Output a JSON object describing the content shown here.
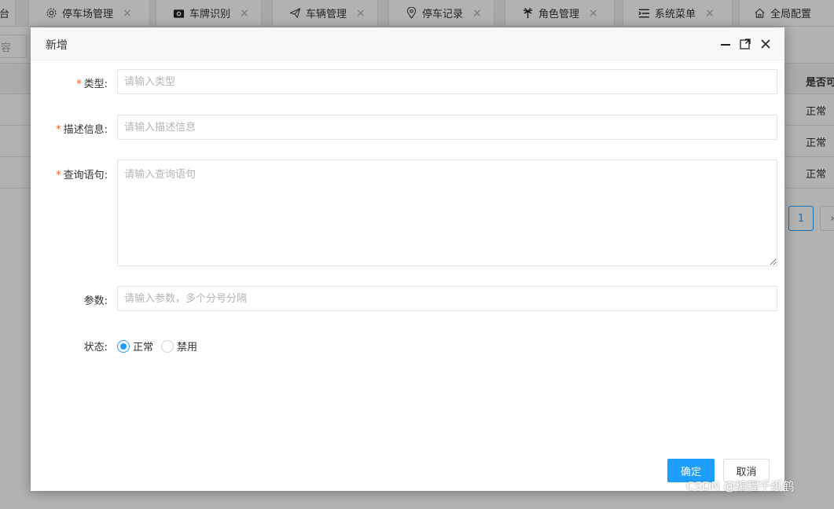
{
  "tabs": [
    {
      "label": "台",
      "icon": "none",
      "show_close": false
    },
    {
      "label": "停车场管理",
      "icon": "gear-icon",
      "show_close": true
    },
    {
      "label": "车牌识别",
      "icon": "camera-icon",
      "show_close": true
    },
    {
      "label": "车辆管理",
      "icon": "send-icon",
      "show_close": true
    },
    {
      "label": "停车记录",
      "icon": "location-pin-icon",
      "show_close": true
    },
    {
      "label": "角色管理",
      "icon": "palm-icon",
      "show_close": true
    },
    {
      "label": "系统菜单",
      "icon": "menu-list-icon",
      "show_close": true
    },
    {
      "label": "全局配置",
      "icon": "home-icon",
      "show_close": false
    }
  ],
  "background": {
    "search_fragment": "容",
    "table_header_fragment": "是否可",
    "rows": [
      {
        "status": "正常"
      },
      {
        "status": "正常"
      },
      {
        "status": "正常"
      }
    ],
    "pager": {
      "current_page": "1",
      "next": "›"
    }
  },
  "modal": {
    "title": "新增",
    "controls": {
      "minimize": "minimize-icon",
      "maximize": "maximize-icon",
      "close": "close-icon"
    },
    "fields": {
      "type": {
        "label": "类型:",
        "required": true,
        "placeholder": "请输入类型",
        "value": ""
      },
      "description": {
        "label": "描述信息:",
        "required": true,
        "placeholder": "请输入描述信息",
        "value": ""
      },
      "query": {
        "label": "查询语句:",
        "required": true,
        "placeholder": "请输入查询语句",
        "value": ""
      },
      "params": {
        "label": "参数:",
        "required": false,
        "placeholder": "请输入参数，多个分号分隔",
        "value": ""
      },
      "status": {
        "label": "状态:",
        "options": [
          "正常",
          "禁用"
        ],
        "selected": "正常"
      }
    },
    "buttons": {
      "confirm": "确定",
      "cancel": "取消"
    }
  },
  "watermark": "CSDN @编程千纸鹤",
  "colors": {
    "primary": "#1e9fff",
    "required": "#ff5722"
  }
}
